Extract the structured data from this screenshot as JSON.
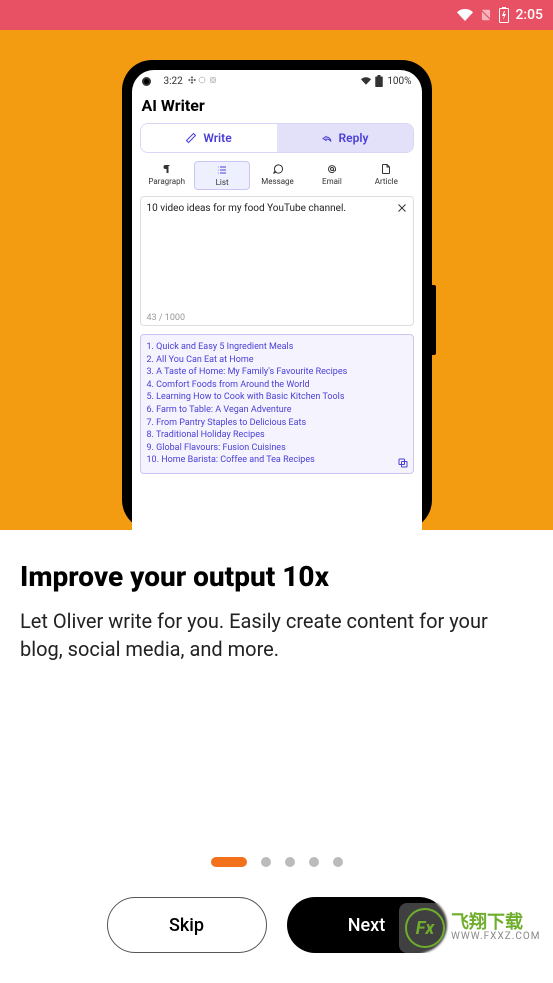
{
  "outer_status": {
    "time": "2:05"
  },
  "inner_status": {
    "time": "3:22",
    "battery": "100%"
  },
  "app": {
    "title": "AI Writer",
    "segments": {
      "write": "Write",
      "reply": "Reply"
    },
    "tabs": {
      "paragraph": "Paragraph",
      "list": "List",
      "message": "Message",
      "email": "Email",
      "article": "Article"
    },
    "input": {
      "text": "10 video ideas for my food YouTube channel.",
      "counter": "43 / 1000"
    },
    "output": {
      "items": [
        "1. Quick and Easy 5 Ingredient Meals",
        "2. All You Can Eat at Home",
        "3. A Taste of Home: My Family's Favourite Recipes",
        "4. Comfort Foods from Around the World",
        "5. Learning How to Cook with Basic Kitchen Tools",
        "6. Farm to Table: A Vegan Adventure",
        "7. From Pantry Staples to Delicious Eats",
        "8. Traditional Holiday Recipes",
        "9. Global Flavours: Fusion Cuisines",
        "10. Home Barista: Coffee and Tea Recipes"
      ]
    }
  },
  "onboarding": {
    "headline": "Improve your output 10x",
    "subtitle": "Let Oliver write for you. Easily create content for your blog, social media, and more.",
    "page_count": 5,
    "active_page": 0,
    "skip": "Skip",
    "next": "Next"
  },
  "watermark": {
    "big": "飞翔下载",
    "small": "WWW.FXXZ.COM"
  }
}
